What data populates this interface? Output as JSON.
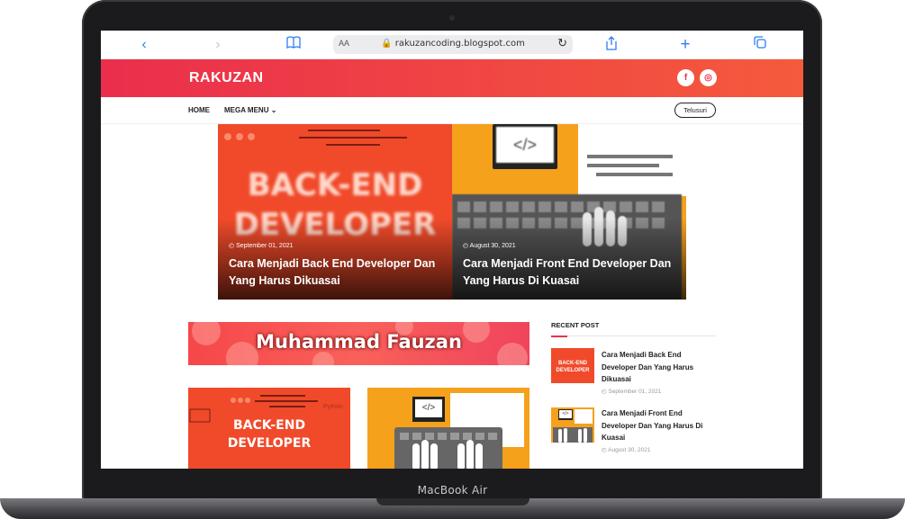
{
  "device": {
    "label": "MacBook Air"
  },
  "browser": {
    "text_size_label": "AA",
    "url": "rakuzancoding.blogspot.com",
    "icons": [
      "back-icon",
      "forward-icon",
      "bookmarks-icon",
      "lock-icon",
      "reload-icon",
      "share-icon",
      "new-tab-icon",
      "tabs-icon"
    ]
  },
  "site": {
    "name": "RAKUZAN",
    "social": [
      {
        "icon": "facebook-icon",
        "glyph": "f"
      },
      {
        "icon": "instagram-icon",
        "glyph": "◎"
      }
    ],
    "nav": {
      "home": "HOME",
      "mega_menu": "MEGA MENU",
      "mega_chevron": "⌄",
      "search_label": "Telusuri"
    }
  },
  "featured": [
    {
      "image_text": [
        "BACK-END",
        "DEVELOPER"
      ],
      "date": "September 01, 2021",
      "title": "Cara Menjadi Back End Developer Dan Yang Harus Dikuasai"
    },
    {
      "image_text": [
        "</>"
      ],
      "date": "August 30, 2021",
      "title": "Cara Menjadi Front End Developer Dan Yang Harus Di Kuasai"
    }
  ],
  "banner": {
    "text": "Muhammad Fauzan"
  },
  "cards": [
    {
      "image_text": [
        "BACK-END",
        "DEVELOPER"
      ],
      "corner_text": "Python"
    },
    {
      "image_text": [
        "</>"
      ]
    }
  ],
  "sidebar": {
    "heading": "RECENT POST",
    "posts": [
      {
        "thumb_text": [
          "BACK-END",
          "DEVELOPER"
        ],
        "title": "Cara Menjadi Back End Developer Dan Yang Harus Dikuasai",
        "date": "September 01, 2021"
      },
      {
        "thumb_text": [
          "</>"
        ],
        "title": "Cara Menjadi Front End Developer Dan Yang Harus Di Kuasai",
        "date": "August 30, 2021"
      }
    ]
  },
  "colors": {
    "brand_start": "#ea2e4c",
    "brand_end": "#f55a3c",
    "accent": "#e8344a",
    "link_blue": "#2f7cf6",
    "orange": "#f5a11c"
  }
}
